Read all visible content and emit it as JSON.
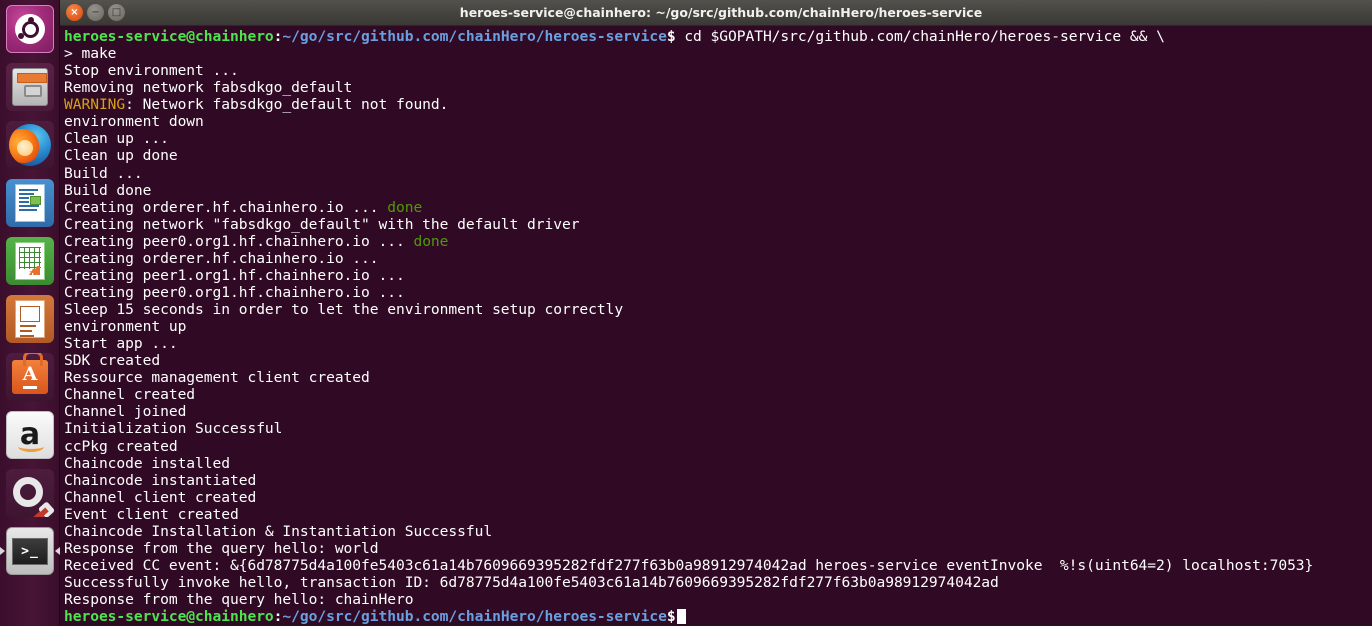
{
  "launcher": {
    "items": [
      {
        "name": "ubuntu-dash",
        "label": "Ubuntu Dash Home"
      },
      {
        "name": "files",
        "label": "Files"
      },
      {
        "name": "firefox",
        "label": "Firefox Web Browser"
      },
      {
        "name": "libreoffice-writer",
        "label": "LibreOffice Writer"
      },
      {
        "name": "libreoffice-calc",
        "label": "LibreOffice Calc"
      },
      {
        "name": "libreoffice-impress",
        "label": "LibreOffice Impress"
      },
      {
        "name": "ubuntu-software-center",
        "label": "Ubuntu Software Center"
      },
      {
        "name": "amazon",
        "label": "Amazon"
      },
      {
        "name": "system-settings",
        "label": "System Settings"
      },
      {
        "name": "terminal",
        "label": "Terminal"
      }
    ],
    "amazon_glyph": "a",
    "software_glyph": "A",
    "terminal_glyph": ">_"
  },
  "window": {
    "title": "heroes-service@chainhero: ~/go/src/github.com/chainHero/heroes-service",
    "close_glyph": "×",
    "minimize_glyph": "−",
    "maximize_glyph": "□"
  },
  "terminal": {
    "prompt_user": "heroes-service@chainhero",
    "prompt_colon": ":",
    "prompt_path": "~/go/src/github.com/chainHero/heroes-service",
    "prompt_dollar": "$",
    "first_command": " cd $GOPATH/src/github.com/chainHero/heroes-service && \\",
    "continuation": "> make",
    "lines": [
      "Stop environment ...",
      "Removing network fabsdkgo_default",
      "environment down",
      "Clean up ...",
      "Clean up done",
      "Build ...",
      "Build done"
    ],
    "warning_label": "WARNING",
    "warning_rest": ": Network fabsdkgo_default not found.",
    "creating": [
      {
        "text": "Creating orderer.hf.chainhero.io ... ",
        "done": "done"
      },
      {
        "text": "Creating network \"fabsdkgo_default\" with the default driver",
        "done": ""
      },
      {
        "text": "Creating peer0.org1.hf.chainhero.io ... ",
        "done": "done"
      },
      {
        "text": "Creating orderer.hf.chainhero.io ...",
        "done": ""
      },
      {
        "text": "Creating peer1.org1.hf.chainhero.io ...",
        "done": ""
      },
      {
        "text": "Creating peer0.org1.hf.chainhero.io ...",
        "done": ""
      }
    ],
    "lines2": [
      "Sleep 15 seconds in order to let the environment setup correctly",
      "environment up",
      "Start app ...",
      "SDK created",
      "Ressource management client created",
      "Channel created",
      "Channel joined",
      "Initialization Successful",
      "ccPkg created",
      "Chaincode installed",
      "Chaincode instantiated",
      "Channel client created",
      "Event client created",
      "Chaincode Installation & Instantiation Successful",
      "Response from the query hello: world",
      "Received CC event: &{6d78775d4a100fe5403c61a14b7609669395282fdf277f63b0a98912974042ad heroes-service eventInvoke  %!s(uint64=2) localhost:7053}",
      "Successfully invoke hello, transaction ID: 6d78775d4a100fe5403c61a14b7609669395282fdf277f63b0a98912974042ad",
      "Response from the query hello: chainHero"
    ]
  },
  "colors": {
    "terminal_bg": "#300a24",
    "titlebar_bg": "#3c3b37",
    "launcher_bg": "#3b0e2c",
    "prompt_green": "#4ee44e",
    "prompt_blue": "#6a9fe0",
    "warning_yellow": "#d6a017",
    "done_green": "#4e9a06",
    "text_white": "#ffffff"
  }
}
